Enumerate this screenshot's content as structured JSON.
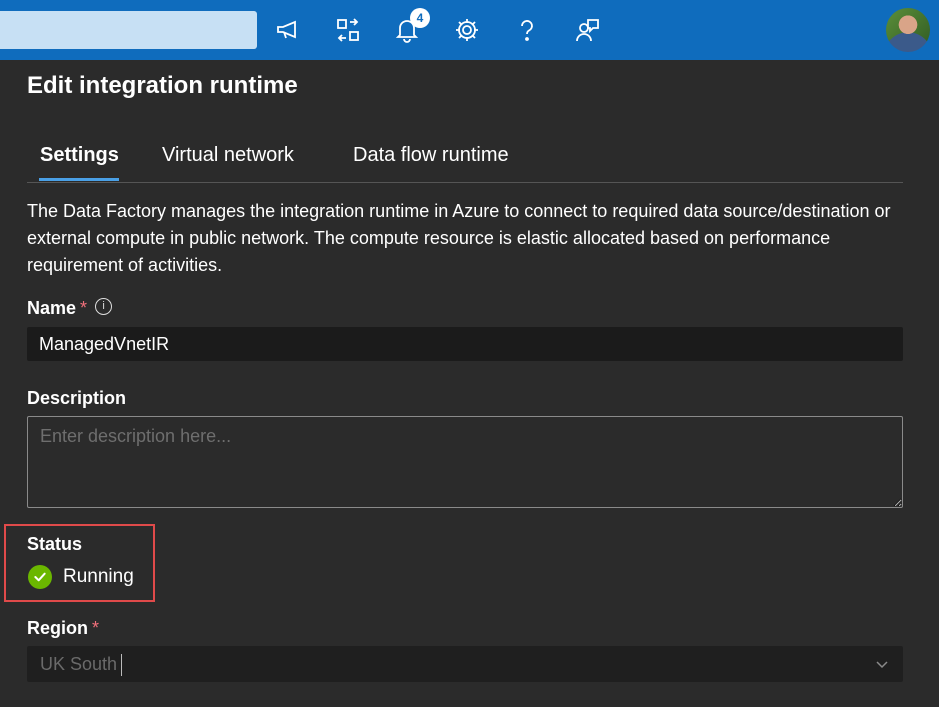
{
  "topbar": {
    "search_value": "",
    "icons": [
      "announcement-icon",
      "switch-directory-icon",
      "notifications-icon",
      "settings-icon",
      "help-icon",
      "feedback-icon"
    ],
    "notification_count": "4",
    "color": "#0f6cbd"
  },
  "panel": {
    "title": "Edit integration runtime",
    "tabs": [
      {
        "label": "Settings",
        "active": true
      },
      {
        "label": "Virtual network",
        "active": false
      },
      {
        "label": "Data flow runtime",
        "active": false
      }
    ],
    "description": "The Data Factory manages the integration runtime in Azure to connect to required data source/destination or external compute in public network. The compute resource is elastic allocated based on performance requirement of activities."
  },
  "form": {
    "name": {
      "label": "Name",
      "required_mark": "*",
      "info_icon": "i",
      "value": "ManagedVnetIR"
    },
    "description": {
      "label": "Description",
      "placeholder": "Enter description here..."
    },
    "status": {
      "label": "Status",
      "value": "Running",
      "icon": "check-circle-icon",
      "color": "#6bb700"
    },
    "region": {
      "label": "Region",
      "required_mark": "*",
      "value": "UK South"
    }
  },
  "colors": {
    "accent": "#4aa0e6",
    "highlight_border": "#e04a4a",
    "background": "#2b2b2b"
  }
}
